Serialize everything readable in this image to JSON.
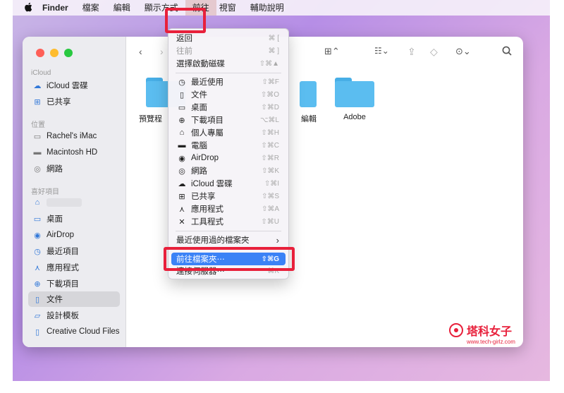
{
  "menubar": {
    "apple": "",
    "items": [
      "Finder",
      "檔案",
      "編輯",
      "顯示方式",
      "前往",
      "視窗",
      "輔助說明"
    ]
  },
  "sidebar": {
    "sections": {
      "icloud": "iCloud",
      "locations": "位置",
      "favorites": "喜好項目"
    },
    "icloud_items": [
      {
        "label": "iCloud 雲碟",
        "icon": "cloud-icon"
      },
      {
        "label": "已共享",
        "icon": "shared-folder-icon"
      }
    ],
    "location_items": [
      {
        "label": "Rachel's iMac",
        "icon": "imac-icon"
      },
      {
        "label": "Macintosh HD",
        "icon": "disk-icon"
      },
      {
        "label": "網路",
        "icon": "globe-icon"
      }
    ],
    "favorite_items": [
      {
        "label": "",
        "icon": "home-icon"
      },
      {
        "label": "桌面",
        "icon": "desktop-icon"
      },
      {
        "label": "AirDrop",
        "icon": "airdrop-icon"
      },
      {
        "label": "最近項目",
        "icon": "clock-icon"
      },
      {
        "label": "應用程式",
        "icon": "apps-icon"
      },
      {
        "label": "下載項目",
        "icon": "download-icon"
      },
      {
        "label": "文件",
        "icon": "document-icon"
      },
      {
        "label": "設計模板",
        "icon": "folder-icon"
      },
      {
        "label": "Creative Cloud Files",
        "icon": "file-icon"
      }
    ]
  },
  "content": {
    "folders": [
      "預覽程",
      "",
      "編輯",
      "Adobe"
    ]
  },
  "go_menu": {
    "items": [
      {
        "label": "返回",
        "shortcut": "⌘ [",
        "icon": "",
        "dim": false
      },
      {
        "label": "往前",
        "shortcut": "⌘ ]",
        "icon": "",
        "dim": true
      },
      {
        "label": "選擇啟動磁碟",
        "shortcut": "⇧⌘▲",
        "icon": "",
        "dim": false
      },
      {
        "label": "最近使用",
        "shortcut": "⇧⌘F",
        "icon": "clock-icon",
        "dim": false
      },
      {
        "label": "文件",
        "shortcut": "⇧⌘O",
        "icon": "document-icon",
        "dim": false
      },
      {
        "label": "桌面",
        "shortcut": "⇧⌘D",
        "icon": "desktop-icon",
        "dim": false
      },
      {
        "label": "下載項目",
        "shortcut": "⌥⌘L",
        "icon": "download-icon",
        "dim": false
      },
      {
        "label": "個人專屬",
        "shortcut": "⇧⌘H",
        "icon": "home-icon",
        "dim": false
      },
      {
        "label": "電腦",
        "shortcut": "⇧⌘C",
        "icon": "computer-icon",
        "dim": false
      },
      {
        "label": "AirDrop",
        "shortcut": "⇧⌘R",
        "icon": "airdrop-icon",
        "dim": false
      },
      {
        "label": "網路",
        "shortcut": "⇧⌘K",
        "icon": "globe-icon",
        "dim": false
      },
      {
        "label": "iCloud 雲碟",
        "shortcut": "⇧⌘I",
        "icon": "cloud-icon",
        "dim": false
      },
      {
        "label": "已共享",
        "shortcut": "⇧⌘S",
        "icon": "shared-folder-icon",
        "dim": false
      },
      {
        "label": "應用程式",
        "shortcut": "⇧⌘A",
        "icon": "apps-icon",
        "dim": false
      },
      {
        "label": "工具程式",
        "shortcut": "⇧⌘U",
        "icon": "tools-icon",
        "dim": false
      },
      {
        "label": "最近使用過的檔案夾",
        "shortcut": "›",
        "icon": "",
        "dim": false
      },
      {
        "label": "前往檔案夾⋯",
        "shortcut": "⇧⌘G",
        "icon": "",
        "dim": false
      },
      {
        "label": "連接伺服器⋯",
        "shortcut": "⌘K",
        "icon": "",
        "dim": false
      }
    ]
  },
  "watermark": {
    "name": "塔科女子",
    "url": "www.tech-girlz.com"
  },
  "colors": {
    "accent": "#3b82f6",
    "highlight": "#e8203b",
    "folder": "#5bbdf0"
  }
}
